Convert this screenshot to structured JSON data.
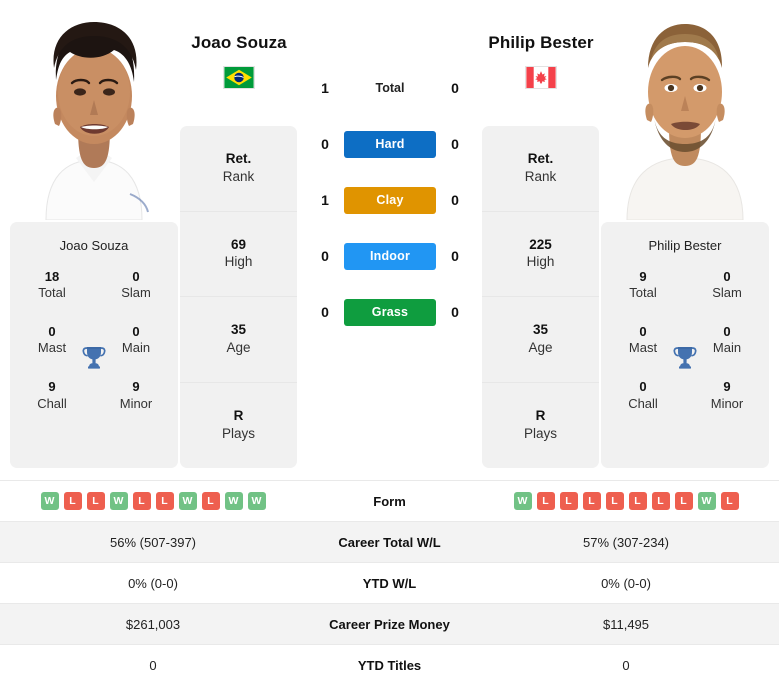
{
  "players": {
    "left": {
      "name": "Joao Souza",
      "flag": "brazil-flag",
      "card_name": "Joao Souza",
      "titles": [
        {
          "num": "18",
          "label": "Total"
        },
        {
          "num": "0",
          "label": "Slam"
        },
        {
          "num": "0",
          "label": "Mast"
        },
        {
          "num": "0",
          "label": "Main"
        },
        {
          "num": "9",
          "label": "Chall"
        },
        {
          "num": "9",
          "label": "Minor"
        }
      ],
      "ranks": [
        {
          "num": "Ret.",
          "label": "Rank"
        },
        {
          "num": "69",
          "label": "High"
        },
        {
          "num": "35",
          "label": "Age"
        },
        {
          "num": "R",
          "label": "Plays"
        }
      ],
      "form": [
        "W",
        "L",
        "L",
        "W",
        "L",
        "L",
        "W",
        "L",
        "W",
        "W"
      ],
      "career_total_wl": "56% (507-397)",
      "ytd_wl": "0% (0-0)",
      "career_prize_money": "$261,003",
      "ytd_titles": "0"
    },
    "right": {
      "name": "Philip Bester",
      "flag": "canada-flag",
      "card_name": "Philip Bester",
      "titles": [
        {
          "num": "9",
          "label": "Total"
        },
        {
          "num": "0",
          "label": "Slam"
        },
        {
          "num": "0",
          "label": "Mast"
        },
        {
          "num": "0",
          "label": "Main"
        },
        {
          "num": "0",
          "label": "Chall"
        },
        {
          "num": "9",
          "label": "Minor"
        }
      ],
      "ranks": [
        {
          "num": "Ret.",
          "label": "Rank"
        },
        {
          "num": "225",
          "label": "High"
        },
        {
          "num": "35",
          "label": "Age"
        },
        {
          "num": "R",
          "label": "Plays"
        }
      ],
      "form": [
        "W",
        "L",
        "L",
        "L",
        "L",
        "L",
        "L",
        "L",
        "W",
        "L"
      ],
      "career_total_wl": "57% (307-234)",
      "ytd_wl": "0% (0-0)",
      "career_prize_money": "$11,495",
      "ytd_titles": "0"
    }
  },
  "h2h": [
    {
      "label": "Total",
      "left": "1",
      "right": "0",
      "type": "plain",
      "color": ""
    },
    {
      "label": "Hard",
      "left": "0",
      "right": "0",
      "type": "badge",
      "color": "#0d6ec4"
    },
    {
      "label": "Clay",
      "left": "1",
      "right": "0",
      "type": "badge",
      "color": "#e09400"
    },
    {
      "label": "Indoor",
      "left": "0",
      "right": "0",
      "type": "badge",
      "color": "#2196f3"
    },
    {
      "label": "Grass",
      "left": "0",
      "right": "0",
      "type": "badge",
      "color": "#0f9d3f"
    }
  ],
  "table_rows": [
    {
      "label": "Form",
      "key": "form",
      "type": "form"
    },
    {
      "label": "Career Total W/L",
      "key": "career_total_wl",
      "type": "text"
    },
    {
      "label": "YTD W/L",
      "key": "ytd_wl",
      "type": "text"
    },
    {
      "label": "Career Prize Money",
      "key": "career_prize_money",
      "type": "text"
    },
    {
      "label": "YTD Titles",
      "key": "ytd_titles",
      "type": "text"
    }
  ],
  "colors": {
    "win_badge": "#71c285",
    "loss_badge": "#ee5f4f",
    "card_bg": "#f1f1f1",
    "row_alt_bg": "#f3f3f3",
    "trophy": "#4472b0"
  },
  "icons": {
    "trophy": "trophy-icon",
    "brazil_flag": "brazil-flag-icon",
    "canada_flag": "canada-flag-icon"
  }
}
